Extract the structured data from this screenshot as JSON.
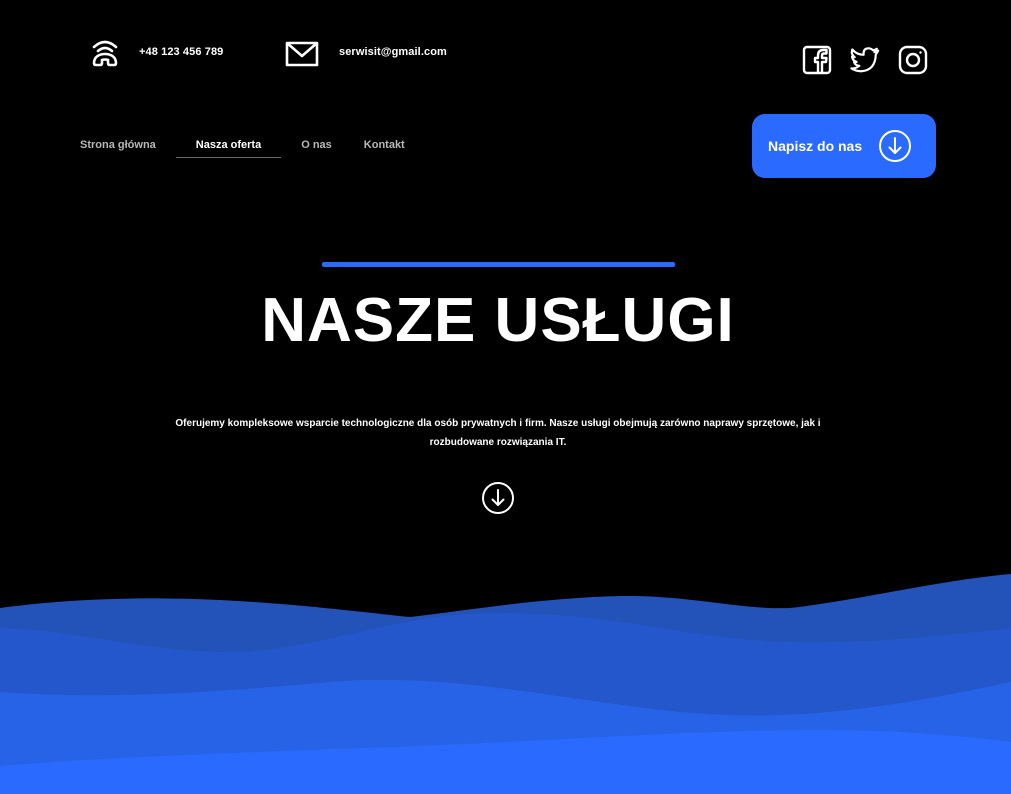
{
  "contact": {
    "phone": "+48 123 456 789",
    "email": "serwisit@gmail.com",
    "phone_icon": "phone-signal-icon",
    "email_icon": "envelope-icon"
  },
  "social": [
    "facebook-icon",
    "twitter-icon",
    "instagram-icon"
  ],
  "nav": {
    "items": [
      {
        "label": "Strona główna"
      },
      {
        "label": "Nasza oferta",
        "active": true
      },
      {
        "label": "O nas"
      },
      {
        "label": "Kontakt"
      }
    ]
  },
  "cta": {
    "label": "Napisz do nas",
    "icon": "arrow-down-circle-icon"
  },
  "hero": {
    "title": "NASZE USŁUGI",
    "description": "Oferujemy kompleksowe wsparcie technologiczne dla osób prywatnych i firm. Nasze usługi obejmują zarówno naprawy sprzętowe, jak i rozbudowane rozwiązania IT."
  },
  "colors": {
    "background": "#000000",
    "accent": "#2a6aff",
    "wave_dark": "#2352b8",
    "wave_mid": "#2660d8",
    "wave_light": "#2a6aff"
  }
}
